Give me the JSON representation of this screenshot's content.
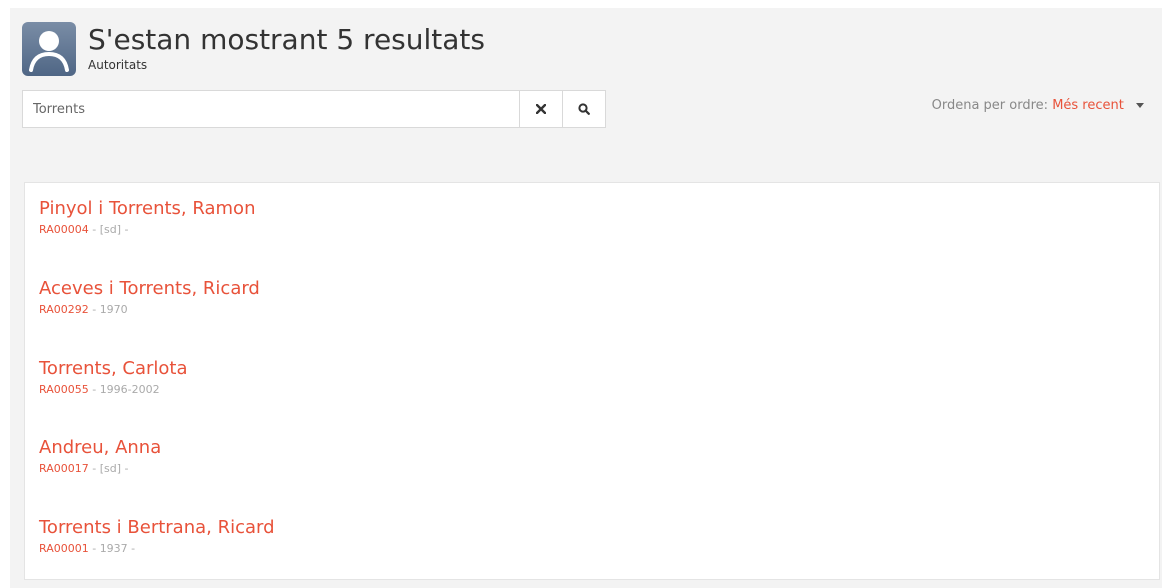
{
  "header": {
    "title": "S'estan mostrant 5 resultats",
    "subtitle": "Autoritats"
  },
  "search": {
    "value": "Torrents",
    "clear_icon": "close-icon",
    "search_icon": "search-icon"
  },
  "sort": {
    "label": "Ordena per ordre:",
    "value": "Més recent"
  },
  "results": [
    {
      "title": "Pinyol i Torrents, Ramon",
      "id": "RA00004",
      "sep1": " - ",
      "date": "[sd]",
      "sep2": " -"
    },
    {
      "title": "Aceves i Torrents, Ricard",
      "id": "RA00292",
      "sep1": " - ",
      "date": "1970",
      "sep2": ""
    },
    {
      "title": "Torrents, Carlota",
      "id": "RA00055",
      "sep1": " - ",
      "date": "1996-2002",
      "sep2": ""
    },
    {
      "title": "Andreu, Anna",
      "id": "RA00017",
      "sep1": " - ",
      "date": "[sd]",
      "sep2": " -"
    },
    {
      "title": "Torrents i Bertrana, Ricard",
      "id": "RA00001",
      "sep1": " - ",
      "date": "1937",
      "sep2": " -"
    }
  ],
  "colors": {
    "accent": "#e8523a",
    "avatar": "#5a7091"
  }
}
